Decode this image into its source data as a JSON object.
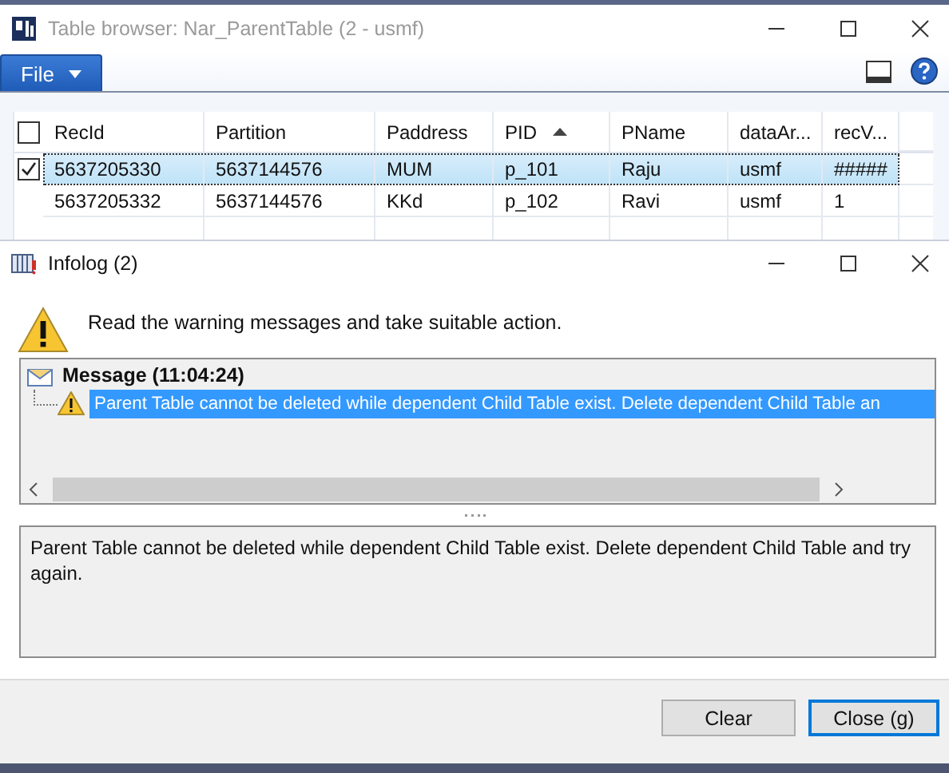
{
  "table_browser": {
    "title": "Table browser: Nar_ParentTable (2 - usmf)",
    "menu_tab": "File",
    "grid": {
      "header_checked": false,
      "columns": [
        {
          "label": "RecId",
          "sorted": false
        },
        {
          "label": "Partition",
          "sorted": false
        },
        {
          "label": "Paddress",
          "sorted": false
        },
        {
          "label": "PID",
          "sorted": true
        },
        {
          "label": "PName",
          "sorted": false
        },
        {
          "label": "dataAr...",
          "sorted": false
        },
        {
          "label": "recV...",
          "sorted": false
        }
      ],
      "rows": [
        {
          "selected": true,
          "checked": true,
          "cells": [
            "5637205330",
            "5637144576",
            "MUM",
            "p_101",
            "Raju",
            "usmf",
            "#####"
          ]
        },
        {
          "selected": false,
          "checked": false,
          "cells": [
            "5637205332",
            "5637144576",
            "KKd",
            "p_102",
            "Ravi",
            "usmf",
            "1"
          ]
        }
      ]
    }
  },
  "infolog": {
    "title": "Infolog (2)",
    "instruction": "Read the warning messages and take suitable action.",
    "tree": [
      {
        "label": "Message (11:04:24)",
        "children": [
          {
            "label": "Parent Table cannot be deleted while dependent Child Table exist. Delete dependent Child Table an",
            "selected": true
          }
        ]
      }
    ],
    "detail": "Parent Table cannot be deleted while dependent Child Table exist. Delete dependent Child Table and try again.",
    "buttons": [
      {
        "label": "Clear",
        "default": false
      },
      {
        "label": "Close (g)",
        "default": true
      }
    ]
  }
}
